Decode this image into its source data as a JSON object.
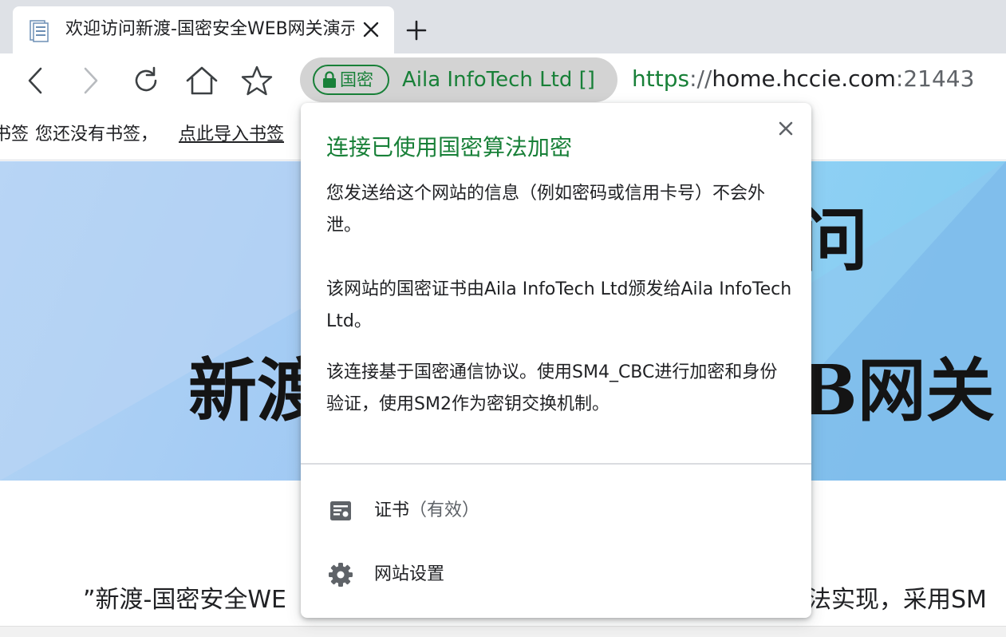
{
  "tab": {
    "title": "欢迎访问新渡-国密安全WEB网关演示",
    "favicon": "document-icon"
  },
  "toolbar": {
    "back_icon": "back-arrow-icon",
    "forward_icon": "forward-arrow-icon",
    "reload_icon": "reload-icon",
    "home_icon": "home-icon",
    "star_icon": "star-icon"
  },
  "omnibox": {
    "badge_label": "国密",
    "org_name": "Aila InfoTech Ltd []",
    "url_scheme": "https",
    "url_sep": "://",
    "url_host": "home.hccie.com",
    "url_port": ":21443",
    "secure_color": "#188038"
  },
  "bookmarks": {
    "label_fragment": "书签",
    "empty_text": "您还没有书签，",
    "import_link": "点此导入书签"
  },
  "page": {
    "banner_line1": "新渡",
    "banner_line1_right": "B网关",
    "banner_top_glyph": "问",
    "intro_left": "”新渡-国密安全WE",
    "intro_right": "法实现，采用SM"
  },
  "popup": {
    "title": "连接已使用国密算法加密",
    "para1": "您发送给这个网站的信息（例如密码或信用卡号）不会外泄。",
    "para2": "该网站的国密证书由Aila InfoTech Ltd颁发给Aila InfoTech Ltd。",
    "para3": "该连接基于国密通信协议。使用SM4_CBC进行加密和身份验证，使用SM2作为密钥交换机制。",
    "cert_label": "证书",
    "cert_status": "（有效）",
    "settings_label": "网站设置"
  }
}
